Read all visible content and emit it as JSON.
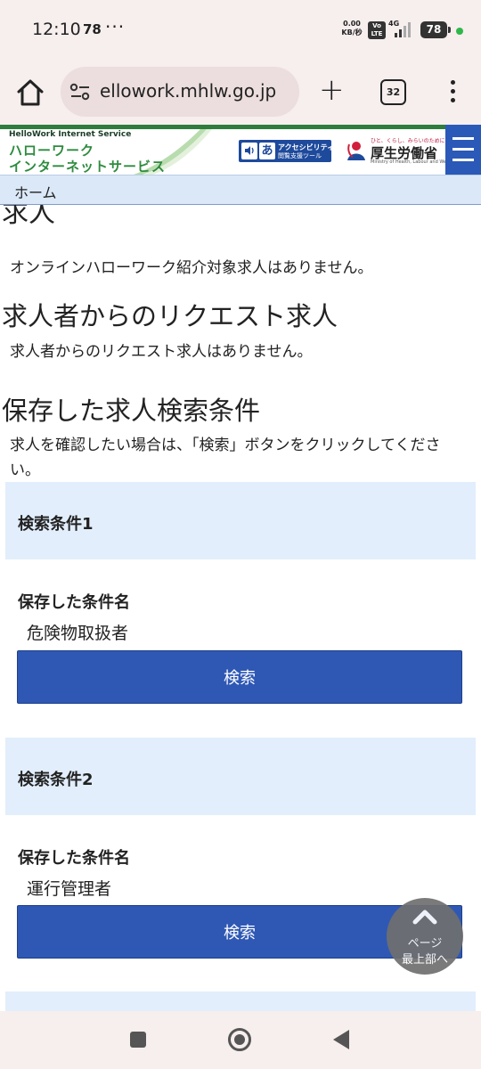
{
  "status_bar": {
    "time": "12:10",
    "notification_count": "78",
    "more": "···",
    "net_speed_value": "0.00",
    "net_speed_unit": "KB/秒",
    "volte_top": "Vo",
    "volte_bottom": "LTE",
    "network": "4G",
    "battery": "78",
    "colors": {
      "indicator_dot": "#2fb84a"
    }
  },
  "browser": {
    "url": "ellowork.mhlw.go.jp",
    "tab_count": "32",
    "icons": [
      "home-icon",
      "site-settings-icon",
      "new-tab-icon",
      "tabs-icon",
      "menu-icon"
    ]
  },
  "site_header": {
    "service_en": "HelloWork Internet Service",
    "service_ja_line1": "ハローワーク",
    "service_ja_line2": "インターネットサービス",
    "accessibility_badge_glyph1": "あ",
    "accessibility_title": "アクセシビリティ",
    "accessibility_sub": "閲覧支援ツール",
    "ministry_tagline": "ひと、くらし、みらいのために",
    "ministry_name": "厚生労働省",
    "ministry_en": "Ministry of Health, Labour and Welfare",
    "colors": {
      "brand_green": "#2e8b3f",
      "menu_blue": "#2b59b8"
    }
  },
  "breadcrumb": {
    "home": "ホーム"
  },
  "content": {
    "cut_heading": "求人",
    "online_message": "オンラインハローワーク紹介対象求人はありません。",
    "request_heading": "求人者からのリクエスト求人",
    "request_message": "求人者からのリクエスト求人はありません。",
    "saved_heading": "保存した求人検索条件",
    "saved_message": "求人を確認したい場合は、「検索」ボタンをクリックしてください。",
    "conditions": [
      {
        "title": "検索条件1",
        "name_label": "保存した条件名",
        "name_value": "危険物取扱者",
        "button": "検索"
      },
      {
        "title": "検索条件2",
        "name_label": "保存した条件名",
        "name_value": "運行管理者",
        "button": "検索"
      }
    ],
    "colors": {
      "panel_bg": "#e2eefb",
      "button_bg": "#2f58b5"
    }
  },
  "page_top": {
    "line1": "ページ",
    "line2": "最上部へ"
  }
}
